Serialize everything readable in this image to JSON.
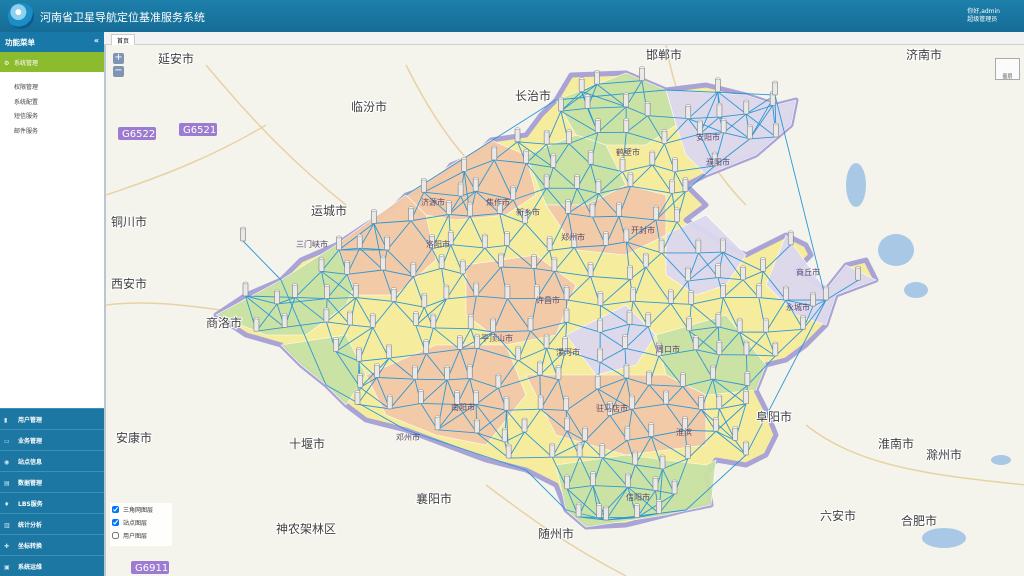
{
  "header": {
    "title": "河南省卫星导航定位基准服务系统",
    "greeting": "你好,admin",
    "role": "超级管理员"
  },
  "sidebar": {
    "title": "功能菜单",
    "collapse": "«",
    "active_group": {
      "label": "系统管理",
      "items": [
        "权限管理",
        "系统配置",
        "短信服务",
        "邮件服务"
      ]
    },
    "bottom_items": [
      {
        "label": "用户管理"
      },
      {
        "label": "业务管理"
      },
      {
        "label": "站点信息"
      },
      {
        "label": "数据管理"
      },
      {
        "label": "LBS服务"
      },
      {
        "label": "统计分析"
      },
      {
        "label": "坐标转换"
      },
      {
        "label": "系统运维"
      }
    ]
  },
  "tabs": [
    {
      "label": "首页"
    }
  ],
  "map": {
    "zoom_in": "+",
    "zoom_out": "−",
    "layer_button": "图层",
    "city_labels": [
      "延安市",
      "邯郸市",
      "济南市",
      "临汾市",
      "长治市",
      "运城市",
      "铜川市",
      "西安市",
      "商洛市",
      "安康市",
      "十堰市",
      "襄阳市",
      "神农架林区",
      "随州市",
      "阜阳市",
      "淮南市",
      "滁州市",
      "六安市",
      "合肥市",
      "郑州市",
      "洛阳市",
      "开封市",
      "许昌市",
      "平顶山市",
      "南阳市",
      "驻马店市",
      "信阳市",
      "周口市",
      "商丘市",
      "焦作市",
      "新乡市",
      "安阳市",
      "濮阳市",
      "三门峡市",
      "漯河市",
      "邓州市",
      "济源市",
      "鹤壁市",
      "永城市",
      "淮滨"
    ],
    "highway_labels": [
      "G6522",
      "G6521",
      "G6911"
    ],
    "layers": [
      {
        "label": "三角网图层",
        "checked": true
      },
      {
        "label": "站点图层",
        "checked": true
      },
      {
        "label": "用户图层",
        "checked": false
      }
    ]
  }
}
